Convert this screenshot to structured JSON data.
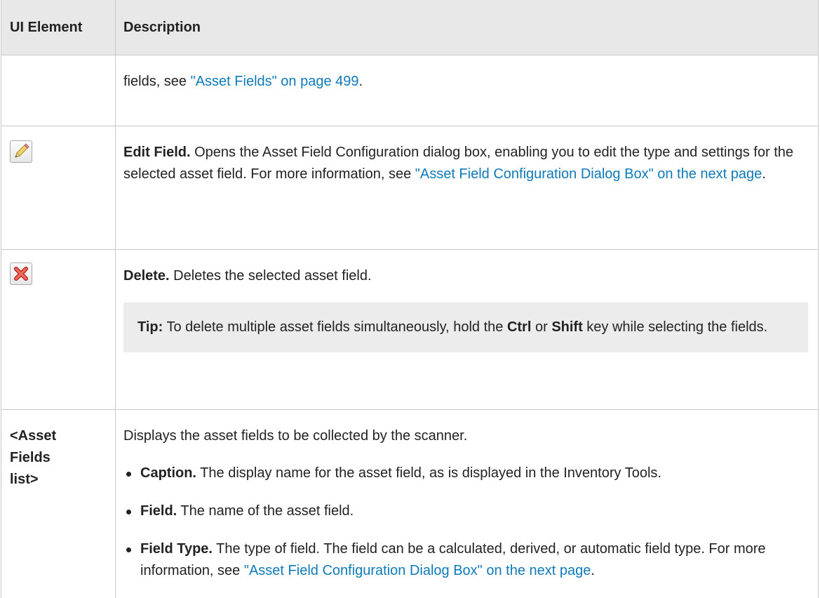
{
  "table": {
    "headers": {
      "element": "UI Element",
      "description": "Description"
    },
    "row1": {
      "text_a": "fields, see ",
      "link": "\"Asset Fields\" on page 499",
      "text_b": "."
    },
    "row2": {
      "icon": "pencil-edit-icon",
      "title": "Edit Field.",
      "text_a": " Opens the Asset Field Configuration dialog box, enabling you to edit the type and settings for the selected asset field. For more information, see ",
      "link": "\"Asset Field Configuration Dialog Box\" on the next page",
      "text_b": "."
    },
    "row3": {
      "icon": "red-x-delete-icon",
      "title": "Delete.",
      "text": " Deletes the selected asset field.",
      "tip": {
        "label": "Tip:",
        "text_a": " To delete multiple asset fields simultaneously, hold the ",
        "key1": "Ctrl",
        "text_b": " or ",
        "key2": "Shift",
        "text_c": " key while selecting the fields."
      }
    },
    "row4": {
      "element_line1": "<Asset",
      "element_line2": "Fields",
      "element_line3": "list>",
      "intro": "Displays the asset fields to be collected by the scanner.",
      "bullets": [
        {
          "title": "Caption.",
          "text": " The display name for the asset field, as is displayed in the Inventory Tools."
        },
        {
          "title": "Field.",
          "text": " The name of the asset field."
        },
        {
          "title": "Field Type.",
          "text": " The type of field. The field can be a calculated, derived, or automatic field type. For more information, see ",
          "link": "\"Asset Field Configuration Dialog Box\" on the next page",
          "text_b": "."
        }
      ]
    }
  },
  "colors": {
    "link": "#0f7ab9",
    "header_bg": "#e8e8e8",
    "tip_bg": "#ececec",
    "border": "#c8c8c8"
  }
}
